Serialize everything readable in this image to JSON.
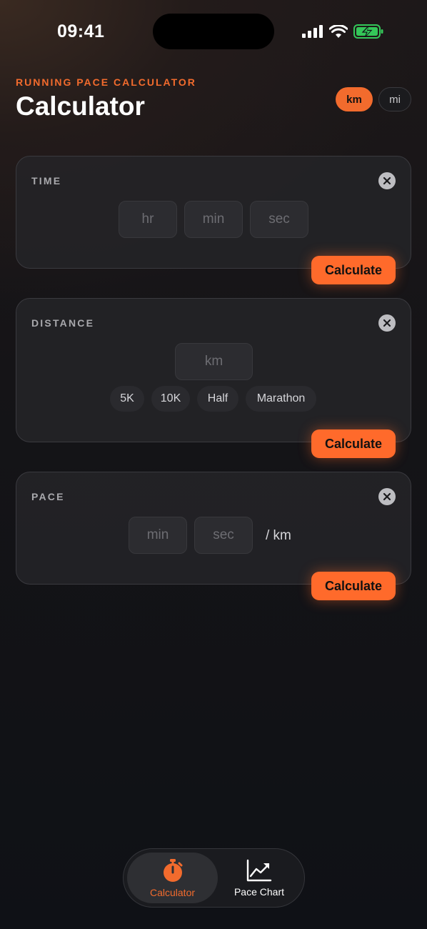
{
  "status_bar": {
    "time": "09:41"
  },
  "header": {
    "eyebrow": "RUNNING PACE CALCULATOR",
    "title": "Calculator",
    "units": {
      "km": "km",
      "mi": "mi",
      "selected": "km"
    }
  },
  "time_card": {
    "label": "TIME",
    "hr_placeholder": "hr",
    "min_placeholder": "min",
    "sec_placeholder": "sec",
    "calculate_label": "Calculate"
  },
  "distance_card": {
    "label": "DISTANCE",
    "distance_placeholder": "km",
    "presets": [
      "5K",
      "10K",
      "Half",
      "Marathon"
    ],
    "calculate_label": "Calculate"
  },
  "pace_card": {
    "label": "PACE",
    "min_placeholder": "min",
    "sec_placeholder": "sec",
    "suffix": "/ km",
    "calculate_label": "Calculate"
  },
  "tab_bar": {
    "tabs": [
      {
        "label": "Calculator",
        "icon": "stopwatch-icon",
        "active": true
      },
      {
        "label": "Pace Chart",
        "icon": "line-chart-icon",
        "active": false
      }
    ]
  },
  "colors": {
    "accent": "#f26b2d",
    "button": "#ff6a2b",
    "battery": "#34c759"
  }
}
